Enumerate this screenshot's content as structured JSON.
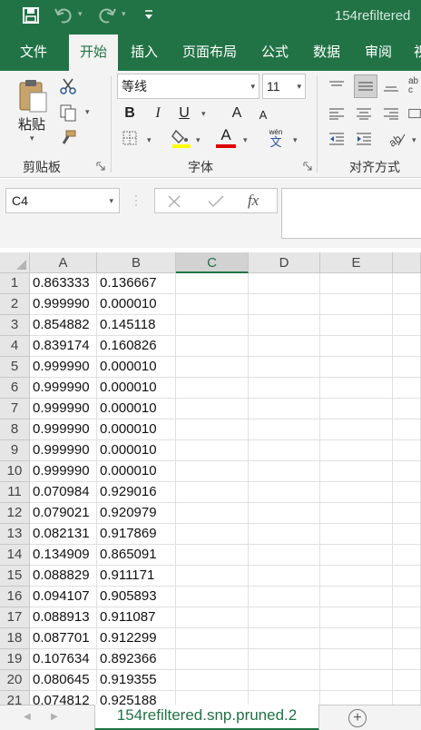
{
  "window": {
    "title": "154refiltered"
  },
  "quick_access": {
    "save_icon": "save-icon",
    "undo_icon": "undo-icon",
    "redo_icon": "redo-icon",
    "customize_icon": "customize-icon"
  },
  "tabs": [
    {
      "label": "文件"
    },
    {
      "label": "开始",
      "active": true
    },
    {
      "label": "插入"
    },
    {
      "label": "页面布局"
    },
    {
      "label": "公式"
    },
    {
      "label": "数据"
    },
    {
      "label": "审阅"
    },
    {
      "label": "视"
    }
  ],
  "ribbon": {
    "clipboard": {
      "label": "剪贴板",
      "paste_label": "粘贴"
    },
    "font": {
      "label": "字体",
      "font_name": "等线",
      "font_size": "11",
      "bold": "B",
      "italic": "I",
      "underline": "U",
      "grow": "A",
      "shrink": "A",
      "font_color": "A",
      "phonetic": "wén",
      "phonetic_sub": "文"
    },
    "alignment": {
      "label": "对齐方式"
    }
  },
  "formula_bar": {
    "name_box": "C4",
    "fx": "fx",
    "value": ""
  },
  "grid": {
    "columns": [
      "A",
      "B",
      "C",
      "D",
      "E"
    ],
    "selected_column": "C",
    "rows": [
      {
        "n": "1",
        "a": "0.863333",
        "b": "0.136667"
      },
      {
        "n": "2",
        "a": "0.999990",
        "b": "0.000010"
      },
      {
        "n": "3",
        "a": "0.854882",
        "b": "0.145118"
      },
      {
        "n": "4",
        "a": "0.839174",
        "b": "0.160826"
      },
      {
        "n": "5",
        "a": "0.999990",
        "b": "0.000010"
      },
      {
        "n": "6",
        "a": "0.999990",
        "b": "0.000010"
      },
      {
        "n": "7",
        "a": "0.999990",
        "b": "0.000010"
      },
      {
        "n": "8",
        "a": "0.999990",
        "b": "0.000010"
      },
      {
        "n": "9",
        "a": "0.999990",
        "b": "0.000010"
      },
      {
        "n": "10",
        "a": "0.999990",
        "b": "0.000010"
      },
      {
        "n": "11",
        "a": "0.070984",
        "b": "0.929016"
      },
      {
        "n": "12",
        "a": "0.079021",
        "b": "0.920979"
      },
      {
        "n": "13",
        "a": "0.082131",
        "b": "0.917869"
      },
      {
        "n": "14",
        "a": "0.134909",
        "b": "0.865091"
      },
      {
        "n": "15",
        "a": "0.088829",
        "b": "0.911171"
      },
      {
        "n": "16",
        "a": "0.094107",
        "b": "0.905893"
      },
      {
        "n": "17",
        "a": "0.088913",
        "b": "0.911087"
      },
      {
        "n": "18",
        "a": "0.087701",
        "b": "0.912299"
      },
      {
        "n": "19",
        "a": "0.107634",
        "b": "0.892366"
      },
      {
        "n": "20",
        "a": "0.080645",
        "b": "0.919355"
      },
      {
        "n": "21",
        "a": "0.074812",
        "b": "0.925188"
      }
    ]
  },
  "sheets": {
    "active": "154refiltered.snp.pruned.2",
    "add_icon": "add-sheet-icon"
  },
  "colors": {
    "brand": "#217346",
    "ribbon_bg": "#f3f3f3",
    "header_bg": "#e6e6e6"
  }
}
